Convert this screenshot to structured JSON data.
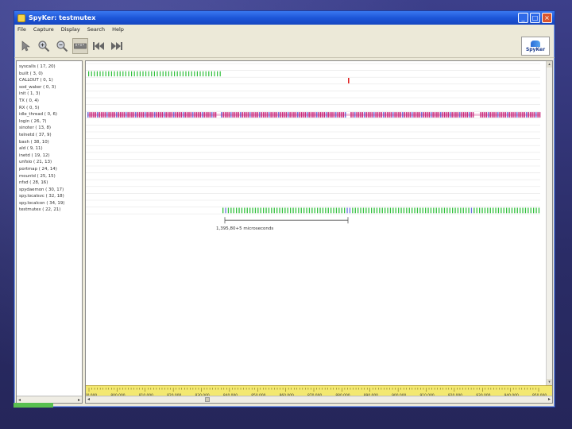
{
  "window": {
    "title": "SpyKer: testmutex",
    "controls": [
      "minimize",
      "maximize",
      "close"
    ]
  },
  "menu": [
    "File",
    "Capture",
    "Display",
    "Search",
    "Help"
  ],
  "toolbar": {
    "buttons": [
      {
        "name": "select-tool",
        "icon": "arrow-pointer-icon"
      },
      {
        "name": "zoom-in",
        "icon": "zoom-in-icon"
      },
      {
        "name": "zoom-out",
        "icon": "zoom-out-icon"
      },
      {
        "name": "measure-tool",
        "icon": "ruler-icon",
        "pressed": true
      },
      {
        "name": "go-first",
        "icon": "skip-back-icon"
      },
      {
        "name": "go-last",
        "icon": "skip-forward-icon"
      }
    ],
    "logo_text": "SpyKer"
  },
  "events": [
    "syscalls ( 17, 20)",
    "built ( 3, 0)",
    "CALLOUT ( 0, 1)",
    "sod_waker ( 0, 3)",
    "init ( 1, 3)",
    "TX ( 0, 4)",
    "RX ( 0, 5)",
    "idle_thread ( 0, 6)",
    "login ( 26, 7)",
    "sinoter ( 13, 8)",
    "telnetd ( 37, 9)",
    "bash ( 38, 10)",
    "ald ( 9, 11)",
    "inetd ( 19, 12)",
    "unfsio ( 21, 13)",
    "portmap ( 24, 14)",
    "mountd ( 25, 15)",
    "nfsd ( 28, 16)",
    "spydaemon ( 30, 17)",
    "spy.localsvc ( 32, 18)",
    "spy.localcon ( 34, 19)",
    "testmutex ( 22, 21)"
  ],
  "measurement": "1,395,80+5 microseconds",
  "ruler_ticks": [
    "000,000",
    "800,000",
    "810,000",
    "820,000",
    "830,000",
    "840,000",
    "850,000",
    "860,000",
    "870,000",
    "880,000",
    "890,000",
    "900,000",
    "910,000",
    "920,000",
    "930,000",
    "940,000",
    "950,000"
  ],
  "colors": {
    "trace_green": "#2fbf3a",
    "trace_magenta": "#c8287a",
    "trace_blue": "#6a70e0",
    "trace_red": "#e02020",
    "ruler_bg": "#f3e870",
    "desktop": "#2d2f6e"
  }
}
